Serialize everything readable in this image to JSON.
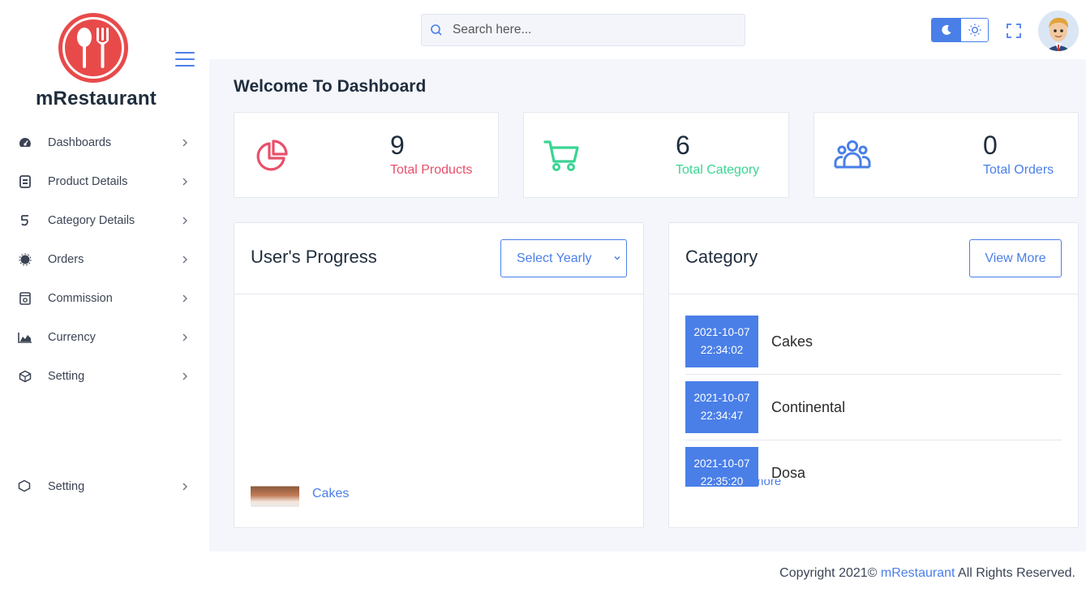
{
  "brand": {
    "name": "mRestaurant"
  },
  "colors": {
    "accent": "#4a7fe8",
    "logo": "#e84a4a",
    "products": "#e8506b",
    "category": "#3bd493",
    "orders": "#4a7fe8"
  },
  "header": {
    "search_placeholder": "Search here..."
  },
  "sidebar": {
    "items": [
      {
        "label": "Dashboards",
        "icon": "dashboard-gauge-icon"
      },
      {
        "label": "Product Details",
        "icon": "product-box-icon"
      },
      {
        "label": "Category Details",
        "icon": "category-icon"
      },
      {
        "label": "Orders",
        "icon": "orders-icon"
      },
      {
        "label": "Commission",
        "icon": "commission-icon"
      },
      {
        "label": "Currency",
        "icon": "area-chart-icon"
      },
      {
        "label": "Setting",
        "icon": "setting-cube-icon"
      }
    ],
    "ghost_label": "Setting"
  },
  "main": {
    "title": "Welcome To Dashboard",
    "stats": [
      {
        "value": "9",
        "label": "Total Products",
        "icon": "pie-chart-icon"
      },
      {
        "value": "6",
        "label": "Total Category",
        "icon": "cart-icon"
      },
      {
        "value": "0",
        "label": "Total Orders",
        "icon": "users-group-icon"
      }
    ],
    "progress_card": {
      "title": "User's Progress",
      "select_value": "Select Yearly",
      "row_label": "Cakes"
    },
    "category_card": {
      "title": "Category",
      "view_more": "View More",
      "items": [
        {
          "date": "2021-10-07",
          "time": "22:34:02",
          "name": "Cakes"
        },
        {
          "date": "2021-10-07",
          "time": "22:34:47",
          "name": "Continental"
        },
        {
          "date": "2021-10-07",
          "time": "22:35:20",
          "name": "Dosa"
        }
      ],
      "more_text": "more"
    }
  },
  "footer": {
    "prefix": "Copyright 2021© ",
    "brand": "mRestaurant",
    "suffix": " All Rights Reserved."
  }
}
